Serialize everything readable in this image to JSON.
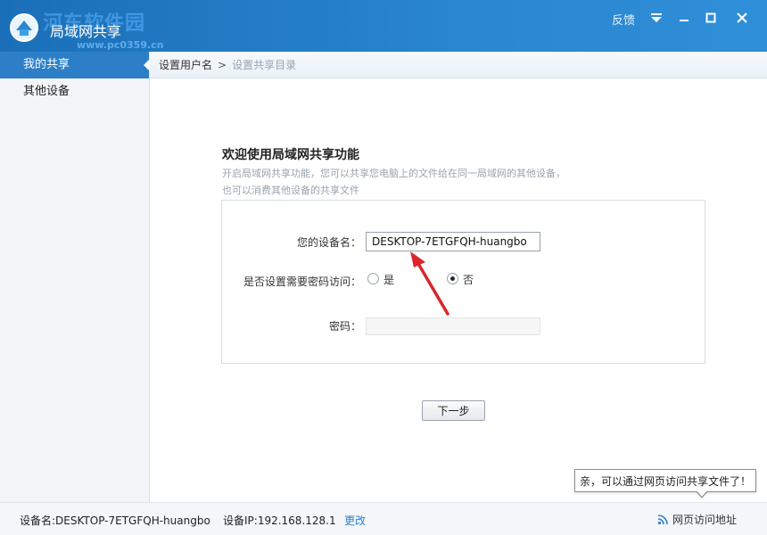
{
  "app": {
    "title": "局域网共享",
    "watermark_text": "河东软件园",
    "watermark_url": "www.pc0359.cn",
    "feedback_label": "反馈"
  },
  "sidebar": {
    "items": [
      {
        "label": "我的共享",
        "active": true
      },
      {
        "label": "其他设备",
        "active": false
      }
    ]
  },
  "breadcrumb": {
    "current": "设置用户名",
    "separator": ">",
    "next": "设置共享目录"
  },
  "welcome": {
    "title": "欢迎使用局域网共享功能",
    "desc_line1": "开启局域网共享功能，您可以共享您电脑上的文件给在同一局域网的其他设备，",
    "desc_line2": "也可以消费其他设备的共享文件"
  },
  "form": {
    "device_label": "您的设备名：",
    "device_value": "DESKTOP-7ETGFQH-huangbo",
    "password_question": "是否设置需要密码访问：",
    "option_yes": "是",
    "option_no": "否",
    "selected": "否",
    "password_label": "密码："
  },
  "next_button": "下一步",
  "tooltip": "亲，可以通过网页访问共享文件了！",
  "status": {
    "device_name": "设备名:DESKTOP-7ETGFQH-huangbo",
    "device_ip": "设备IP:192.168.128.1",
    "change_label": "更改",
    "web_access_label": "网页访问地址"
  },
  "colors": {
    "titlebar": "#2a86cf",
    "sidebar_active": "#2c7fc7",
    "link": "#2a7fd0",
    "annotation_arrow": "#d9262c"
  }
}
